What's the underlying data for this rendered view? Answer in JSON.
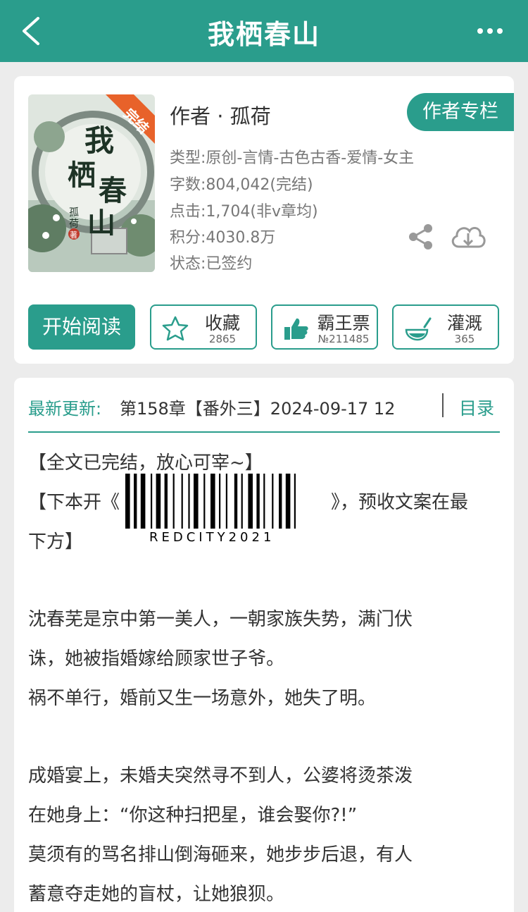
{
  "header": {
    "title": "我栖春山"
  },
  "book": {
    "cover_badge": "完结",
    "cover_title": "我栖春山",
    "cover_author": "孤荷著",
    "author": "作者 · 孤荷",
    "author_column": "作者专栏",
    "genre": "类型:原创-言情-古色古香-爱情-女主",
    "words": "字数:804,042(完结)",
    "clicks": "点击:1,704(非v章均)",
    "score": "积分:4030.8万",
    "status": "状态:已签约"
  },
  "actions": {
    "read": "开始阅读",
    "collect_label": "收藏",
    "collect_count": "2865",
    "ticket_label": "霸王票",
    "ticket_count": "№211485",
    "water_label": "灌溉",
    "water_count": "365"
  },
  "update": {
    "label": "最新更新:",
    "text": "第158章【番外三】2024-09-17 12",
    "toc": "目录"
  },
  "intro": {
    "line1": "【全文已完结，放心可宰~】",
    "line2a": "【下本开《",
    "line2b": "》，预收文案在最",
    "line3": "下方】",
    "watermark": "REDCITY2021",
    "p1a": "沈春芜是京中第一美人，一朝家族失势，满门伏",
    "p1b": "诛，她被指婚嫁给顾家世子爷。",
    "p1c": "祸不单行，婚前又生一场意外，她失了明。",
    "p2a": "成婚宴上，未婚夫突然寻不到人，公婆将烫茶泼",
    "p2b": "在她身上：“你这种扫把星，谁会娶你?!”",
    "p2c": "莫须有的骂名排山倒海砸来，她步步后退，有人",
    "p2d": "蓄意夺走她的盲杖，让她狼狈。"
  },
  "colors": {
    "accent": "#2a9d8c",
    "background": "#ececec"
  }
}
